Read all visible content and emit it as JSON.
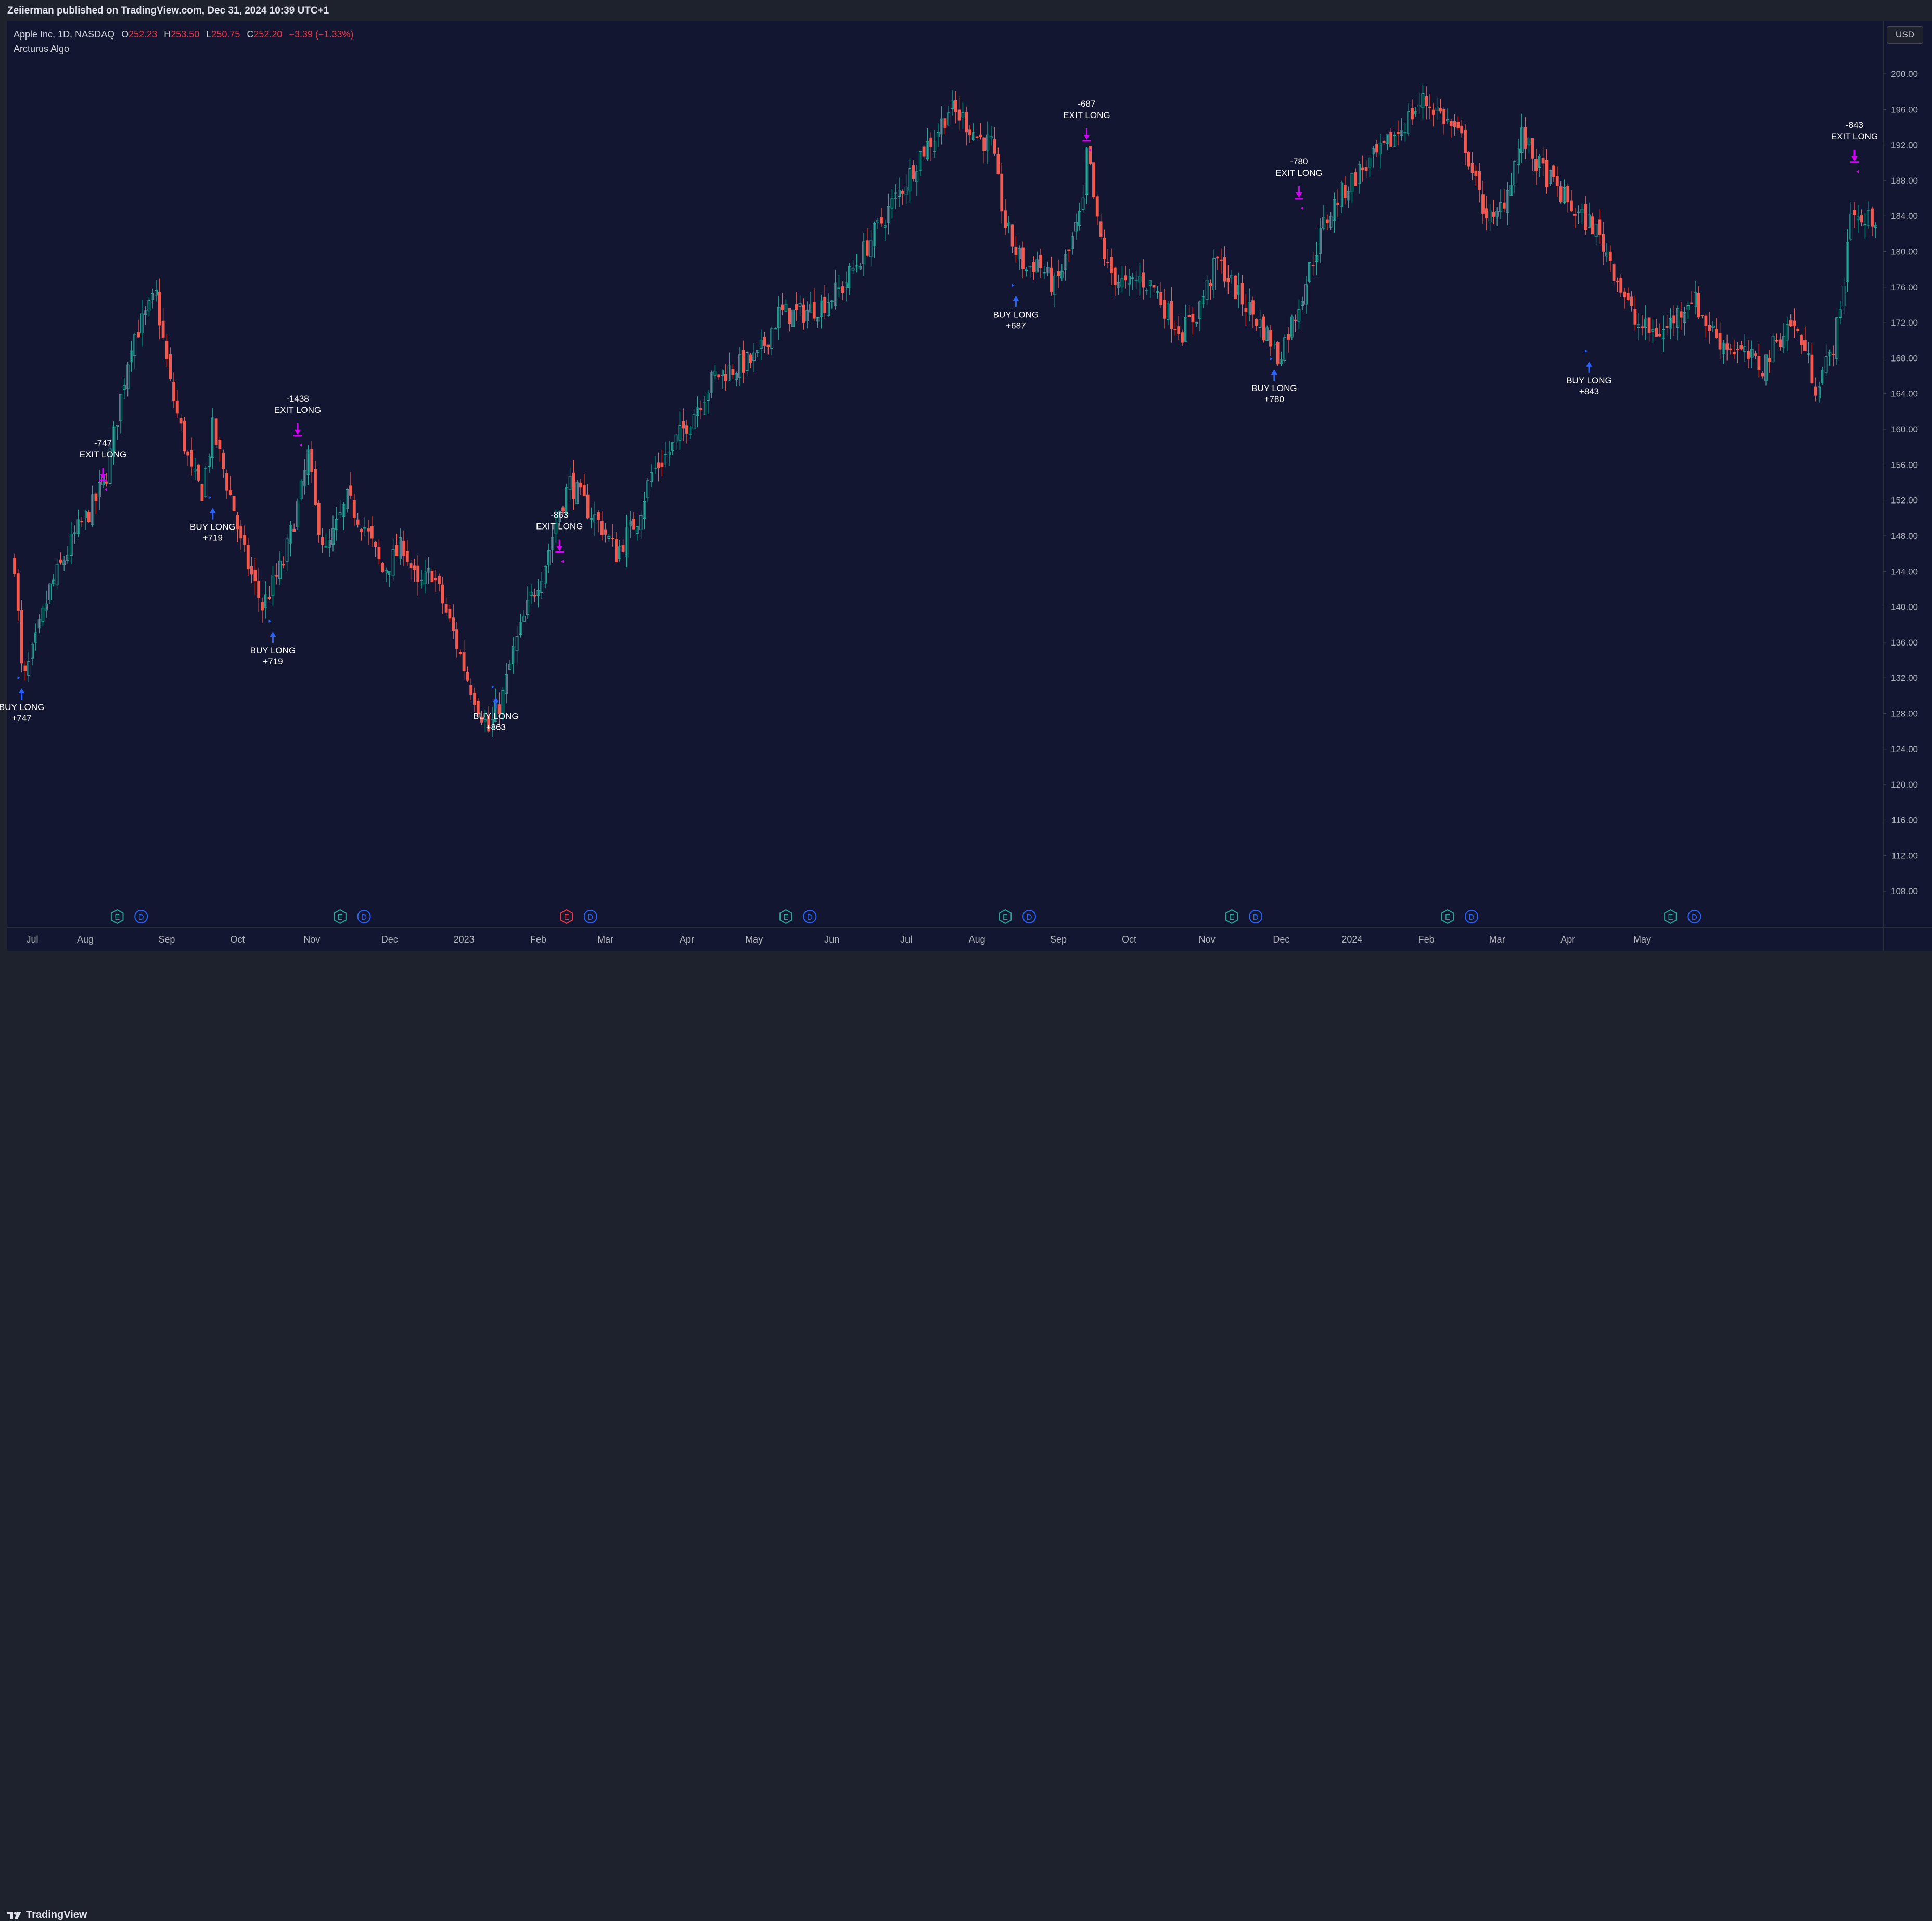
{
  "header": {
    "published": "Zeiierman published on TradingView.com, Dec 31, 2024 10:39 UTC+1"
  },
  "legend": {
    "symbol": "Apple Inc, 1D, NASDAQ",
    "open_label": "O",
    "open": "252.23",
    "high_label": "H",
    "high": "253.50",
    "low_label": "L",
    "low": "250.75",
    "close_label": "C",
    "close": "252.20",
    "change": "−3.39 (−1.33%)",
    "indicator": "Arcturus Algo"
  },
  "currency": "USD",
  "footer": {
    "brand": "TradingView"
  },
  "colors": {
    "bg": "#131631",
    "up": "#26a69a",
    "down": "#f05a50",
    "buy": "#2962ff",
    "exit": "#d500f9",
    "grid": "#1b1f3d"
  },
  "chart_data": {
    "type": "candlestick",
    "symbol": "AAPL",
    "interval": "1D",
    "ylim": [
      105,
      202
    ],
    "y_ticks": [
      "200.00",
      "196.00",
      "192.00",
      "188.00",
      "184.00",
      "180.00",
      "176.00",
      "172.00",
      "168.00",
      "164.00",
      "160.00",
      "156.00",
      "152.00",
      "148.00",
      "144.00",
      "140.00",
      "136.00",
      "132.00",
      "128.00",
      "124.00",
      "120.00",
      "116.00",
      "112.00",
      "108.00"
    ],
    "x_ticks": [
      {
        "label": "Jul",
        "bar": 5
      },
      {
        "label": "Aug",
        "bar": 20
      },
      {
        "label": "Sep",
        "bar": 43
      },
      {
        "label": "Oct",
        "bar": 63
      },
      {
        "label": "Nov",
        "bar": 84
      },
      {
        "label": "Dec",
        "bar": 106
      },
      {
        "label": "2023",
        "bar": 127
      },
      {
        "label": "Feb",
        "bar": 148
      },
      {
        "label": "Mar",
        "bar": 167
      },
      {
        "label": "Apr",
        "bar": 190
      },
      {
        "label": "May",
        "bar": 209
      },
      {
        "label": "Jun",
        "bar": 231
      },
      {
        "label": "Jul",
        "bar": 252
      },
      {
        "label": "Aug",
        "bar": 272
      },
      {
        "label": "Sep",
        "bar": 295
      },
      {
        "label": "Oct",
        "bar": 315
      },
      {
        "label": "Nov",
        "bar": 337
      },
      {
        "label": "Dec",
        "bar": 358
      },
      {
        "label": "2024",
        "bar": 378
      },
      {
        "label": "Feb",
        "bar": 399
      },
      {
        "label": "Mar",
        "bar": 419
      },
      {
        "label": "Apr",
        "bar": 439
      },
      {
        "label": "May",
        "bar": 460
      }
    ],
    "anchors": [
      [
        0,
        145
      ],
      [
        2,
        133
      ],
      [
        3,
        132
      ],
      [
        6,
        136
      ],
      [
        10,
        142
      ],
      [
        17,
        148
      ],
      [
        20,
        150
      ],
      [
        23,
        152
      ],
      [
        26,
        155
      ],
      [
        33,
        170
      ],
      [
        36,
        172
      ],
      [
        40,
        175
      ],
      [
        44,
        165
      ],
      [
        50,
        155
      ],
      [
        53,
        153
      ],
      [
        56,
        160
      ],
      [
        62,
        151
      ],
      [
        64,
        147
      ],
      [
        70,
        140
      ],
      [
        76,
        145
      ],
      [
        81,
        153
      ],
      [
        83,
        157
      ],
      [
        85,
        151
      ],
      [
        88,
        146
      ],
      [
        94,
        152
      ],
      [
        99,
        149
      ],
      [
        104,
        144
      ],
      [
        110,
        147
      ],
      [
        114,
        142
      ],
      [
        118,
        144
      ],
      [
        124,
        137
      ],
      [
        128,
        132
      ],
      [
        132,
        128
      ],
      [
        134,
        126
      ],
      [
        138,
        130
      ],
      [
        141,
        135
      ],
      [
        146,
        141
      ],
      [
        150,
        145
      ],
      [
        154,
        151
      ],
      [
        157,
        154
      ],
      [
        162,
        151
      ],
      [
        166,
        149
      ],
      [
        170,
        146
      ],
      [
        176,
        150
      ],
      [
        180,
        155
      ],
      [
        186,
        158
      ],
      [
        192,
        162
      ],
      [
        198,
        166
      ],
      [
        204,
        167
      ],
      [
        210,
        168
      ],
      [
        216,
        173
      ],
      [
        222,
        173
      ],
      [
        228,
        174
      ],
      [
        234,
        176
      ],
      [
        240,
        180
      ],
      [
        246,
        184
      ],
      [
        252,
        188
      ],
      [
        256,
        191
      ],
      [
        260,
        193
      ],
      [
        264,
        196
      ],
      [
        268,
        195
      ],
      [
        272,
        193
      ],
      [
        276,
        192
      ],
      [
        280,
        183
      ],
      [
        283,
        180
      ],
      [
        286,
        178
      ],
      [
        289,
        179
      ],
      [
        292,
        177
      ],
      [
        294,
        176
      ],
      [
        298,
        180
      ],
      [
        302,
        185
      ],
      [
        303,
        191
      ],
      [
        304,
        189
      ],
      [
        306,
        183
      ],
      [
        309,
        178
      ],
      [
        314,
        176
      ],
      [
        318,
        177
      ],
      [
        322,
        176
      ],
      [
        326,
        173
      ],
      [
        330,
        171
      ],
      [
        334,
        173
      ],
      [
        337,
        176
      ],
      [
        340,
        179
      ],
      [
        343,
        177
      ],
      [
        346,
        175
      ],
      [
        350,
        173
      ],
      [
        355,
        170
      ],
      [
        357,
        168
      ],
      [
        362,
        173
      ],
      [
        366,
        178
      ],
      [
        370,
        183
      ],
      [
        374,
        186
      ],
      [
        380,
        189
      ],
      [
        386,
        191
      ],
      [
        392,
        194
      ],
      [
        398,
        197
      ],
      [
        402,
        196
      ],
      [
        406,
        194
      ],
      [
        410,
        192
      ],
      [
        414,
        186
      ],
      [
        418,
        183
      ],
      [
        422,
        187
      ],
      [
        426,
        193
      ],
      [
        430,
        190
      ],
      [
        434,
        188
      ],
      [
        438,
        186
      ],
      [
        442,
        184
      ],
      [
        446,
        183
      ],
      [
        450,
        180
      ],
      [
        454,
        176
      ],
      [
        458,
        172
      ],
      [
        462,
        171
      ],
      [
        466,
        171
      ],
      [
        470,
        173
      ],
      [
        474,
        175
      ],
      [
        478,
        172
      ],
      [
        482,
        170
      ],
      [
        486,
        169
      ],
      [
        490,
        168
      ],
      [
        494,
        167
      ],
      [
        498,
        170
      ],
      [
        502,
        172
      ],
      [
        505,
        170
      ],
      [
        509,
        165
      ],
      [
        513,
        168
      ],
      [
        516,
        173
      ],
      [
        519,
        185
      ],
      [
        522,
        183
      ],
      [
        526,
        184
      ]
    ],
    "signals": [
      {
        "type": "buy",
        "bar": 2,
        "price": 132.0,
        "label": "BUY LONG",
        "pnl": "+747"
      },
      {
        "type": "exit",
        "bar": 25,
        "price": 153.2,
        "label": "EXIT LONG",
        "pnl": "-747"
      },
      {
        "type": "buy",
        "bar": 56,
        "price": 152.3,
        "label": "BUY LONG",
        "pnl": "+719"
      },
      {
        "type": "exit",
        "bar": 80,
        "price": 158.2,
        "label": "EXIT LONG",
        "pnl": "-1438"
      },
      {
        "type": "buy",
        "bar": 73,
        "price": 138.4,
        "label": "BUY LONG",
        "pnl": "+719"
      },
      {
        "type": "buy",
        "bar": 136,
        "price": 131.0,
        "label": "BUY LONG",
        "pnl": "+863"
      },
      {
        "type": "exit",
        "bar": 154,
        "price": 145.1,
        "label": "EXIT LONG",
        "pnl": "-863"
      },
      {
        "type": "buy",
        "bar": 283,
        "price": 176.2,
        "label": "BUY LONG",
        "pnl": "+687"
      },
      {
        "type": "exit",
        "bar": 303,
        "price": 191.4,
        "label": "EXIT LONG",
        "pnl": "-687"
      },
      {
        "type": "buy",
        "bar": 356,
        "price": 167.9,
        "label": "BUY LONG",
        "pnl": "+780"
      },
      {
        "type": "exit",
        "bar": 363,
        "price": 184.9,
        "label": "EXIT LONG",
        "pnl": "-780"
      },
      {
        "type": "buy",
        "bar": 445,
        "price": 168.8,
        "label": "BUY LONG",
        "pnl": "+843"
      },
      {
        "type": "exit",
        "bar": 520,
        "price": 189.0,
        "label": "EXIT LONG",
        "pnl": "-843"
      }
    ],
    "events": [
      {
        "bar": 29,
        "kind": "E",
        "earnings_color": "#26a69a"
      },
      {
        "bar": 92,
        "kind": "E",
        "earnings_color": "#26a69a"
      },
      {
        "bar": 156,
        "kind": "E",
        "earnings_color": "#f23645"
      },
      {
        "bar": 218,
        "kind": "E",
        "earnings_color": "#26a69a"
      },
      {
        "bar": 280,
        "kind": "E",
        "earnings_color": "#26a69a"
      },
      {
        "bar": 344,
        "kind": "E",
        "earnings_color": "#26a69a"
      },
      {
        "bar": 405,
        "kind": "E",
        "earnings_color": "#26a69a"
      },
      {
        "bar": 468,
        "kind": "E",
        "earnings_color": "#26a69a"
      }
    ],
    "event_dividend_label": "D",
    "grid": false,
    "legend_position": "top-left"
  }
}
